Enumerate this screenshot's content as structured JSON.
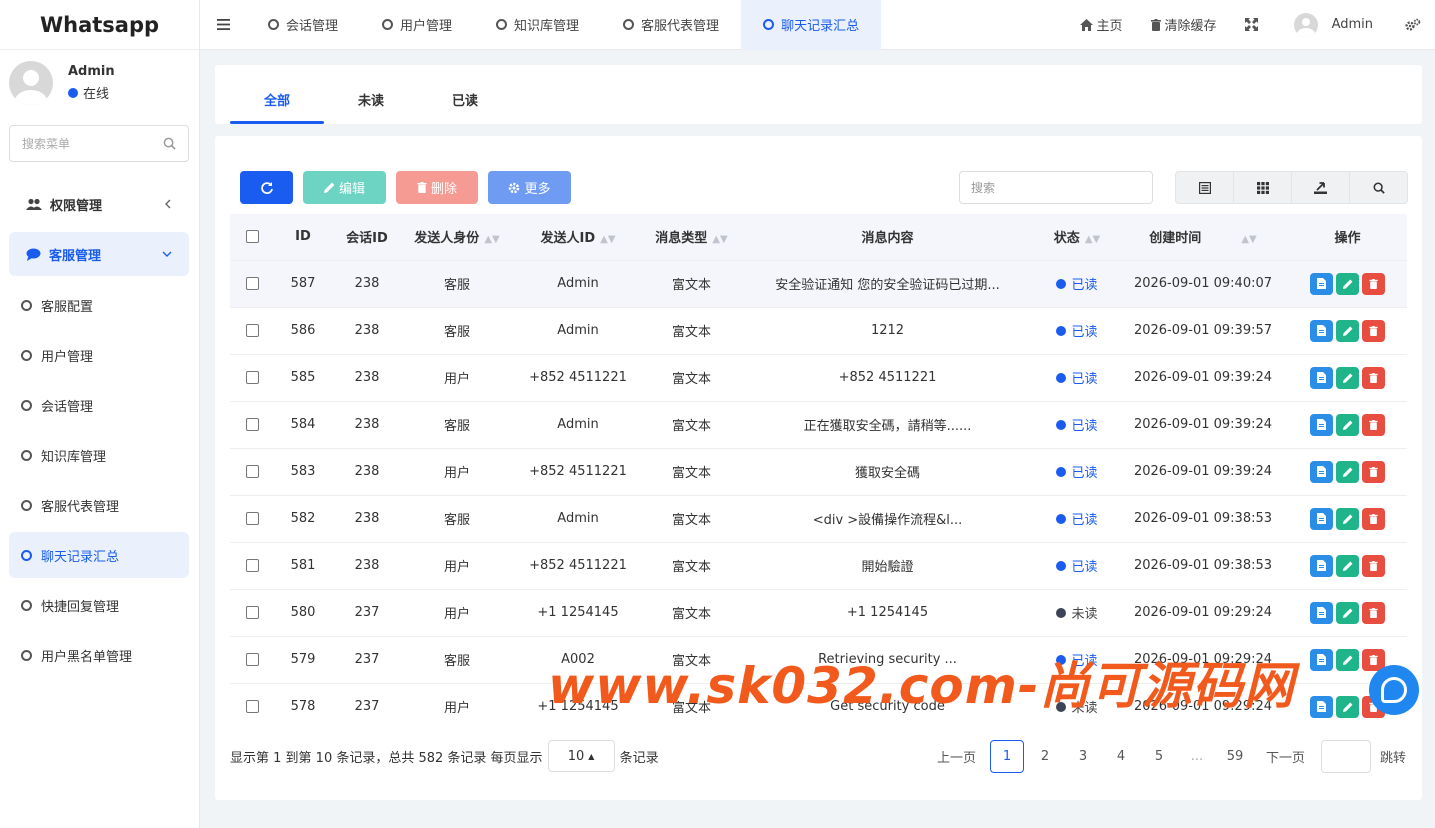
{
  "brand": "Whatsapp",
  "user": {
    "name": "Admin",
    "status": "在线"
  },
  "sidebar": {
    "search_placeholder": "搜索菜单",
    "groups": [
      {
        "label": "权限管理",
        "icon": "users-icon"
      },
      {
        "label": "客服管理",
        "icon": "chat-icon"
      }
    ],
    "items": [
      {
        "label": "客服配置"
      },
      {
        "label": "用户管理"
      },
      {
        "label": "会话管理"
      },
      {
        "label": "知识库管理"
      },
      {
        "label": "客服代表管理"
      },
      {
        "label": "聊天记录汇总"
      },
      {
        "label": "快捷回复管理"
      },
      {
        "label": "用户黑名单管理"
      }
    ]
  },
  "topnav": {
    "tabs": [
      {
        "label": "会话管理"
      },
      {
        "label": "用户管理"
      },
      {
        "label": "知识库管理"
      },
      {
        "label": "客服代表管理"
      },
      {
        "label": "聊天记录汇总"
      }
    ],
    "home": "主页",
    "clear_cache": "清除缓存",
    "admin": "Admin"
  },
  "filters": {
    "all": "全部",
    "unread": "未读",
    "read": "已读"
  },
  "toolbar": {
    "edit": "编辑",
    "delete": "删除",
    "more": "更多",
    "search_placeholder": "搜索"
  },
  "table": {
    "headers": {
      "id": "ID",
      "session_id": "会话ID",
      "sender_role": "发送人身份",
      "sender_id": "发送人ID",
      "msg_type": "消息类型",
      "content": "消息内容",
      "status": "状态",
      "created": "创建时间",
      "ops": "操作"
    },
    "rows": [
      {
        "id": "587",
        "session": "238",
        "role": "客服",
        "sender": "Admin",
        "type": "富文本",
        "content": "安全验证通知 您的安全验证码已过期...",
        "status": "已读",
        "time": "2026-09-01 09:40:07"
      },
      {
        "id": "586",
        "session": "238",
        "role": "客服",
        "sender": "Admin",
        "type": "富文本",
        "content": "1212",
        "status": "已读",
        "time": "2026-09-01 09:39:57"
      },
      {
        "id": "585",
        "session": "238",
        "role": "用户",
        "sender": "+852 4511221",
        "type": "富文本",
        "content": "+852 4511221",
        "status": "已读",
        "time": "2026-09-01 09:39:24"
      },
      {
        "id": "584",
        "session": "238",
        "role": "客服",
        "sender": "Admin",
        "type": "富文本",
        "content": "正在獲取安全碼，請稍等......",
        "status": "已读",
        "time": "2026-09-01 09:39:24"
      },
      {
        "id": "583",
        "session": "238",
        "role": "用户",
        "sender": "+852 4511221",
        "type": "富文本",
        "content": "獲取安全碼",
        "status": "已读",
        "time": "2026-09-01 09:39:24"
      },
      {
        "id": "582",
        "session": "238",
        "role": "客服",
        "sender": "Admin",
        "type": "富文本",
        "content": "<div >設備操作流程&l...",
        "status": "已读",
        "time": "2026-09-01 09:38:53"
      },
      {
        "id": "581",
        "session": "238",
        "role": "用户",
        "sender": "+852 4511221",
        "type": "富文本",
        "content": "開始驗證",
        "status": "已读",
        "time": "2026-09-01 09:38:53"
      },
      {
        "id": "580",
        "session": "237",
        "role": "用户",
        "sender": "+1 1254145",
        "type": "富文本",
        "content": "+1 1254145",
        "status": "未读",
        "time": "2026-09-01 09:29:24"
      },
      {
        "id": "579",
        "session": "237",
        "role": "客服",
        "sender": "A002",
        "type": "富文本",
        "content": "Retrieving security ...",
        "status": "已读",
        "time": "2026-09-01 09:29:24"
      },
      {
        "id": "578",
        "session": "237",
        "role": "用户",
        "sender": "+1 1254145",
        "type": "富文本",
        "content": "Get security code",
        "status": "未读",
        "time": "2026-09-01 09:29:24"
      }
    ]
  },
  "pager": {
    "info_prefix": "显示第 1 到第 10 条记录，总共 582 条记录 每页显示",
    "page_size": "10",
    "info_suffix": "条记录",
    "prev": "上一页",
    "pages": [
      "1",
      "2",
      "3",
      "4",
      "5",
      "...",
      "59"
    ],
    "next": "下一页",
    "jump": "跳转"
  },
  "watermark": "www.sk032.com-尚可源码网",
  "colors": {
    "accent": "#1a5cf0",
    "edit": "#6dd3c3",
    "delete": "#f59b93",
    "more": "#6f9bf3"
  }
}
